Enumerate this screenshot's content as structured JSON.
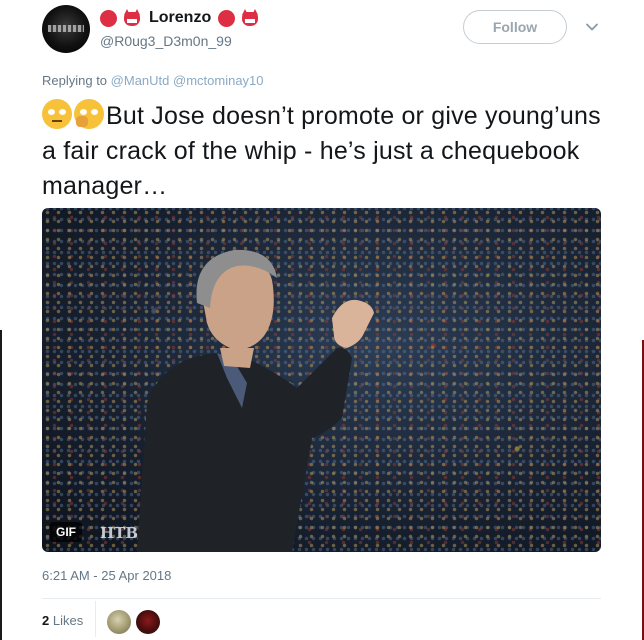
{
  "user": {
    "display_name": "Lorenzo",
    "handle": "@R0ug3_D3m0n_99",
    "avatar_icon": "profile-avatar",
    "name_emoji_icons": [
      "red-circle-icon",
      "japanese-ogre-icon"
    ]
  },
  "actions": {
    "follow_label": "Follow",
    "menu_icon": "chevron-down-icon"
  },
  "reply": {
    "prefix": "Replying to",
    "mentions": [
      "@ManUtd",
      "@mctominay10"
    ]
  },
  "tweet": {
    "emoji_icons": [
      "face-with-rolling-eyes-icon",
      "thinking-face-icon"
    ],
    "text": "But Jose doesn’t promote or give young’uns a fair crack of the whip - he’s just a chequebook manager…"
  },
  "media": {
    "badge": "GIF",
    "watermark": "НТВ"
  },
  "meta": {
    "timestamp": "6:21 AM - 25 Apr 2018"
  },
  "stats": {
    "likes_count": "2",
    "likes_label": "Likes"
  },
  "colors": {
    "text": "#14171a",
    "secondary": "#657786",
    "mention": "#8aa9c4",
    "follow_border": "#c5cdd3",
    "emoji_red": "#dd2e44"
  }
}
